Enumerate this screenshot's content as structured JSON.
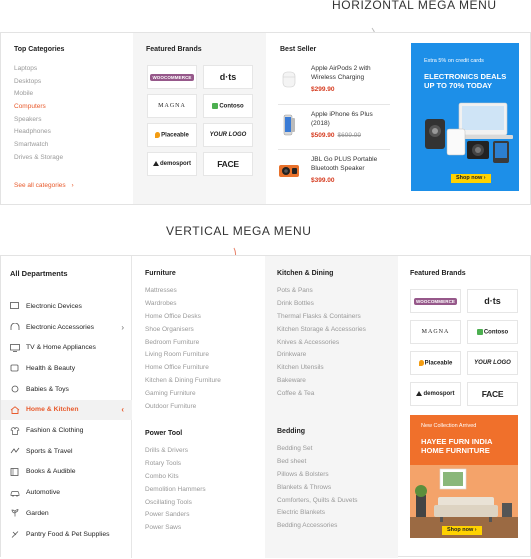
{
  "captions": {
    "horizontal": "HORIZONTAL MEGA MENU",
    "vertical": "VERTICAL MEGA MENU"
  },
  "horizontal_menu": {
    "top_categories": {
      "title": "Top Categories",
      "items": [
        "Laptops",
        "Desktops",
        "Mobile",
        "Computers",
        "Speakers",
        "Headphones",
        "Smartwatch",
        "Drives & Storage"
      ],
      "active_item": "Computers",
      "see_all": "See all categories"
    },
    "featured_brands": {
      "title": "Featured Brands",
      "brands": [
        "WOOCOMMERCE",
        "d·ts",
        "MAGNA",
        "Contoso",
        "Placeable",
        "YOUR LOGO",
        "demosport",
        "FACE"
      ]
    },
    "best_seller": {
      "title": "Best Seller",
      "items": [
        {
          "name": "Apple AirPods 2 with Wireless Charging",
          "price": "$299.90",
          "old_price": ""
        },
        {
          "name": "Apple iPhone 6s Plus (2018)",
          "price": "$509.90",
          "old_price": "$699.99"
        },
        {
          "name": "JBL Go PLUS Portable Bluetooth Speaker",
          "price": "$399.00",
          "old_price": ""
        }
      ]
    },
    "banner": {
      "small_text": "Extra 5% on credit cards",
      "headline": "ELECTRONICS DEALS UP TO 70% TODAY",
      "cta": "Shop now"
    }
  },
  "vertical_menu": {
    "departments": {
      "title": "All Departments",
      "items": [
        {
          "label": "Electronic Devices",
          "icon": "devices-icon",
          "has_submenu": false
        },
        {
          "label": "Electronic Accessories",
          "icon": "headphones-icon",
          "has_submenu": true
        },
        {
          "label": "TV & Home Appliances",
          "icon": "tv-icon",
          "has_submenu": false
        },
        {
          "label": "Health & Beauty",
          "icon": "health-icon",
          "has_submenu": false
        },
        {
          "label": "Babies & Toys",
          "icon": "toys-icon",
          "has_submenu": false
        },
        {
          "label": "Home & Kitchen",
          "icon": "home-icon",
          "has_submenu": true,
          "active": true
        },
        {
          "label": "Fashion & Clothing",
          "icon": "fashion-icon",
          "has_submenu": false
        },
        {
          "label": "Sports & Travel",
          "icon": "sports-icon",
          "has_submenu": false
        },
        {
          "label": "Books & Audible",
          "icon": "books-icon",
          "has_submenu": false
        },
        {
          "label": "Automotive",
          "icon": "car-icon",
          "has_submenu": false
        },
        {
          "label": "Garden",
          "icon": "garden-icon",
          "has_submenu": false
        },
        {
          "label": "Pantry Food & Pet Supplies",
          "icon": "food-icon",
          "has_submenu": false
        }
      ]
    },
    "furniture": {
      "title": "Furniture",
      "items": [
        "Mattresses",
        "Wardrobes",
        "Home Office Desks",
        "Shoe Organisers",
        "Bedroom Furniture",
        "Living Room Furniture",
        "Home Office Furniture",
        "Kitchen & Dining Furniture",
        "Gaming Furniture",
        "Outdoor Furniture"
      ]
    },
    "power_tool": {
      "title": "Power Tool",
      "items": [
        "Drills & Drivers",
        "Rotary Tools",
        "Combo Kits",
        "Demolition Hammers",
        "Oscillating Tools",
        "Power Sanders",
        "Power Saws"
      ]
    },
    "kitchen_dining": {
      "title": "Kitchen & Dining",
      "items": [
        "Pots & Pans",
        "Drink Bottles",
        "Thermal Flasks & Containers",
        "Kitchen Storage & Accessories",
        "Knives & Accessories",
        "Drinkware",
        "Kitchen Utensils",
        "Bakeware",
        "Coffee & Tea"
      ]
    },
    "bedding": {
      "title": "Bedding",
      "items": [
        "Bedding Set",
        "Bed sheet",
        "Pillows & Bolsters",
        "Blankets & Throws",
        "Comforters, Quilts & Duvets",
        "Electric Blankets",
        "Bedding Accessories"
      ]
    },
    "featured_brands": {
      "title": "Featured Brands",
      "brands": [
        "WOOCOMMERCE",
        "d·ts",
        "MAGNA",
        "Contoso",
        "Placeable",
        "YOUR LOGO",
        "demosport",
        "FACE"
      ]
    },
    "banner": {
      "small_text": "New Collection Arrived",
      "headline": "HAYEE FURN INDIA HOME FURNITURE",
      "cta": "Shop now"
    }
  },
  "colors": {
    "accent": "#e85a2c",
    "price": "#d63b1f",
    "banner_blue": "#1d8fe8",
    "banner_orange": "#f0702b",
    "cta_yellow": "#ffd200"
  }
}
